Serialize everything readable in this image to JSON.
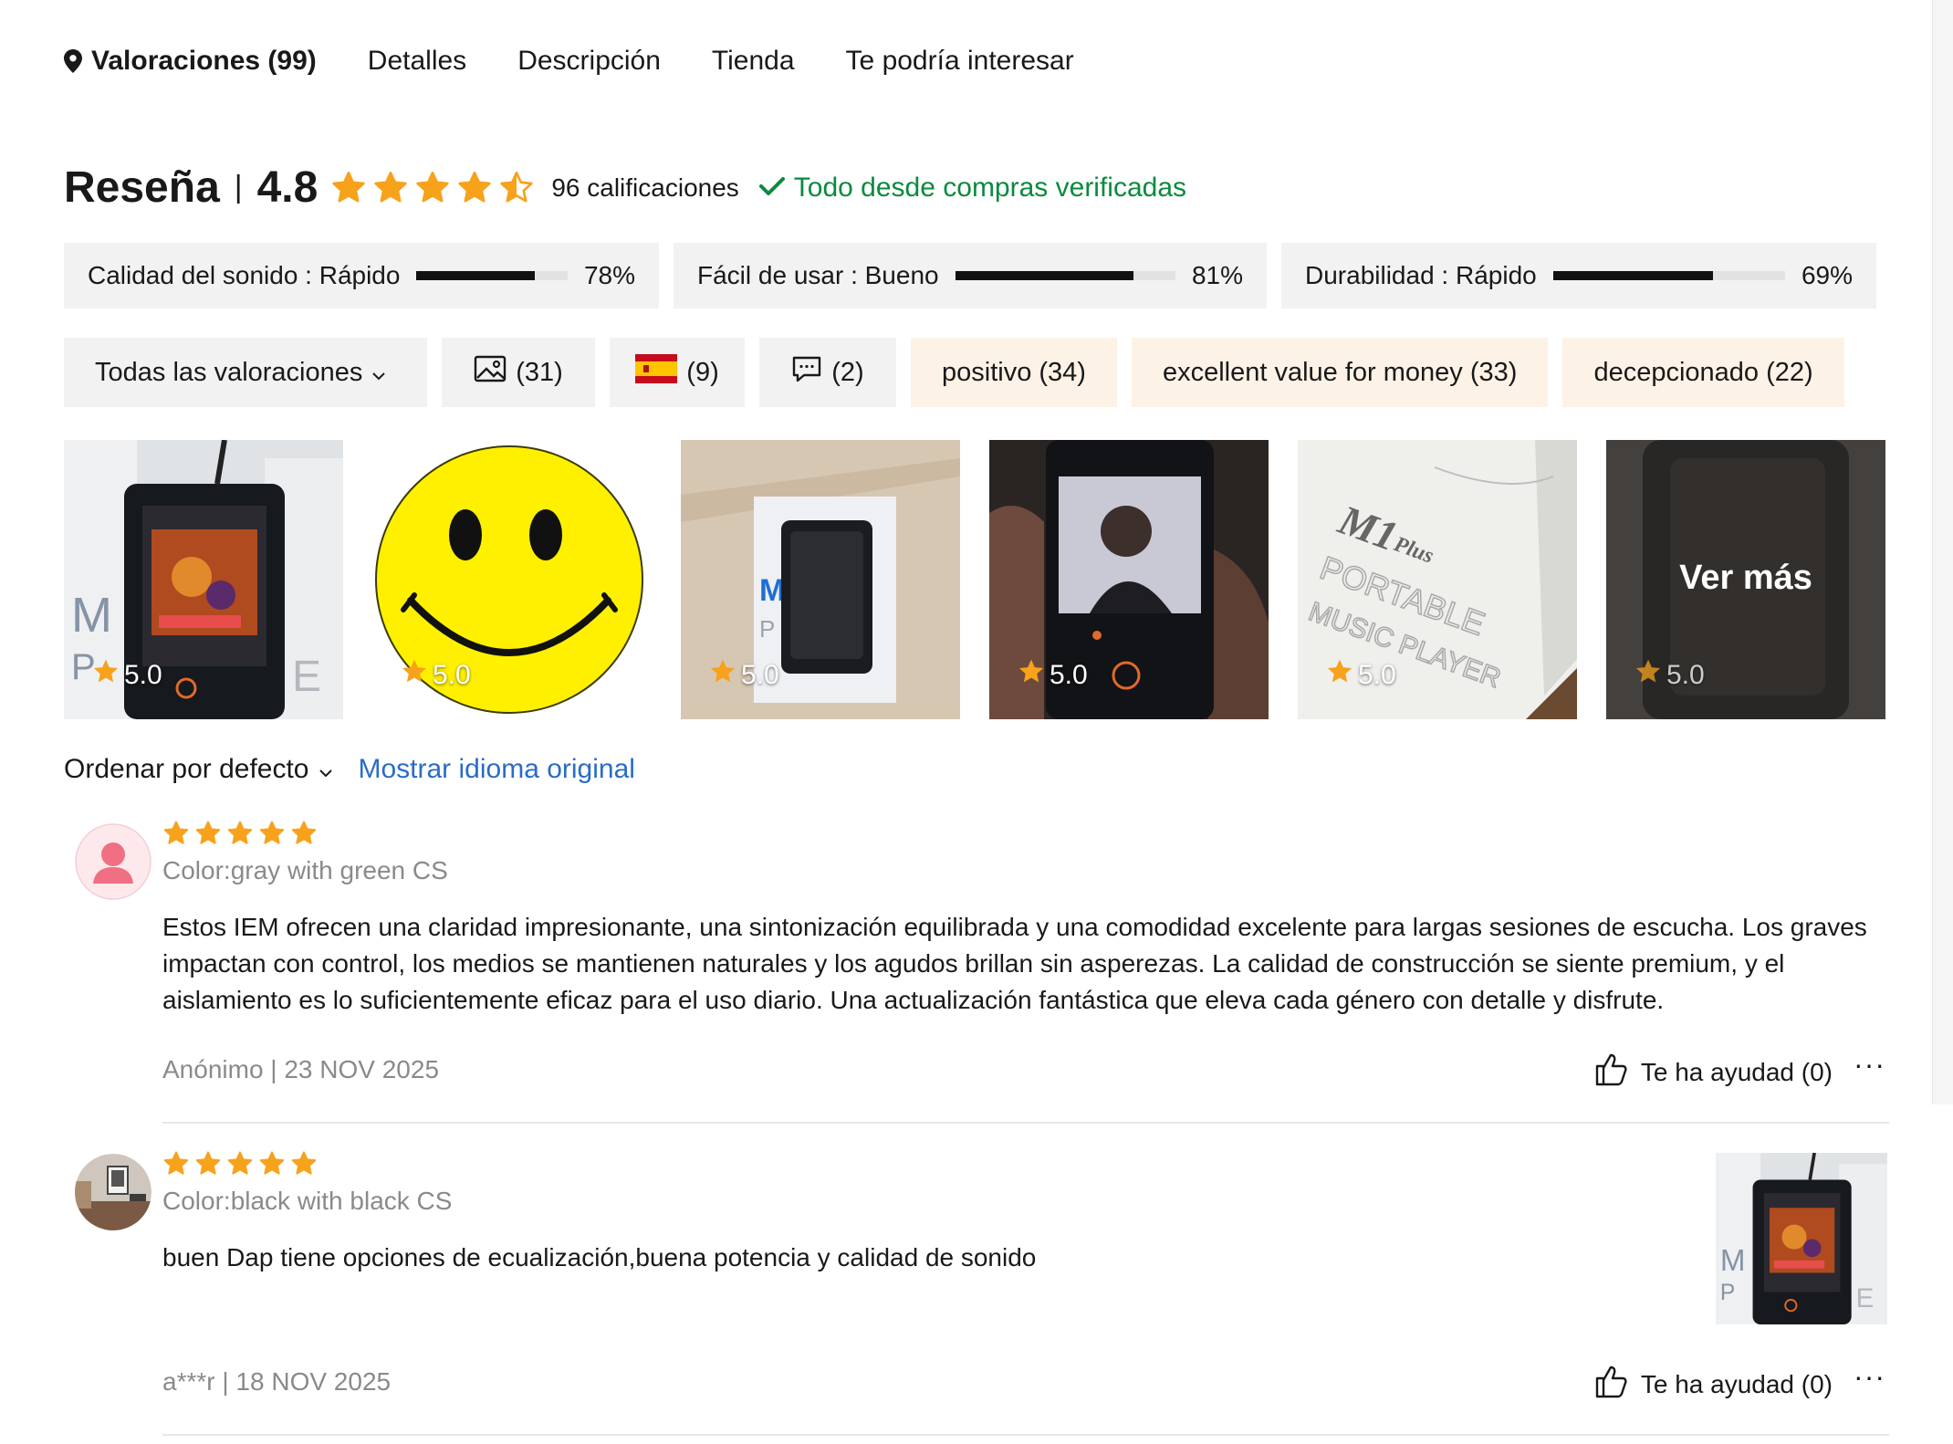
{
  "nav": {
    "tabs": [
      {
        "label": "Valoraciones (99)"
      },
      {
        "label": "Detalles"
      },
      {
        "label": "Descripción"
      },
      {
        "label": "Tienda"
      },
      {
        "label": "Te podría interesar"
      }
    ]
  },
  "summary": {
    "title": "Reseña",
    "separator": "|",
    "score": "4.8",
    "stars_value": 4.8,
    "count": "96 calificaciones",
    "verified": "Todo desde compras verificadas",
    "verified_color": "#0a8a3e",
    "star_color": "#f7a21b"
  },
  "metrics": [
    {
      "label": "Calidad del sonido : Rápido",
      "percent_text": "78%",
      "value": 0.78
    },
    {
      "label": "Fácil de usar : Bueno",
      "percent_text": "81%",
      "value": 0.81
    },
    {
      "label": "Durabilidad : Rápido",
      "percent_text": "69%",
      "value": 0.69
    }
  ],
  "filters": {
    "all": "Todas las valoraciones",
    "photos": "(31)",
    "country": "(9)",
    "comments": "(2)",
    "tags": [
      "positivo (34)",
      "excellent value for money (33)",
      "decepcionado (22)"
    ]
  },
  "thumbnails": [
    {
      "rating": "5.0",
      "desc": "music player on box"
    },
    {
      "rating": "5.0",
      "desc": "smiley face"
    },
    {
      "rating": "5.0",
      "desc": "case on box"
    },
    {
      "rating": "5.0",
      "desc": "player in hand"
    },
    {
      "rating": "5.0",
      "desc": "M1 Plus box"
    },
    {
      "rating": "5.0",
      "more": "Ver más"
    }
  ],
  "sort": {
    "label": "Ordenar por defecto",
    "original": "Mostrar idioma original"
  },
  "reviews": [
    {
      "stars": 5,
      "color": "Color:gray with green CS",
      "text": "Estos IEM ofrecen una claridad impresionante, una sintonización equilibrada y una comodidad excelente para largas sesiones de escucha. Los graves impactan con control, los medios se mantienen naturales y los agudos brillan sin asperezas. La calidad de construcción se siente premium, y el aislamiento es lo suficientemente eficaz para el uso diario. Una actualización fantástica que eleva cada género con detalle y disfrute.",
      "meta": "Anónimo | 23 NOV 2025",
      "helpful": "Te ha ayudad (0)",
      "more": "···"
    },
    {
      "stars": 5,
      "color": "Color:black with black CS",
      "text": "buen Dap tiene opciones de ecualización,buena potencia y calidad de sonido",
      "meta": "a***r | 18 NOV 2025",
      "helpful": "Te ha ayudad (0)",
      "more": "···"
    }
  ]
}
